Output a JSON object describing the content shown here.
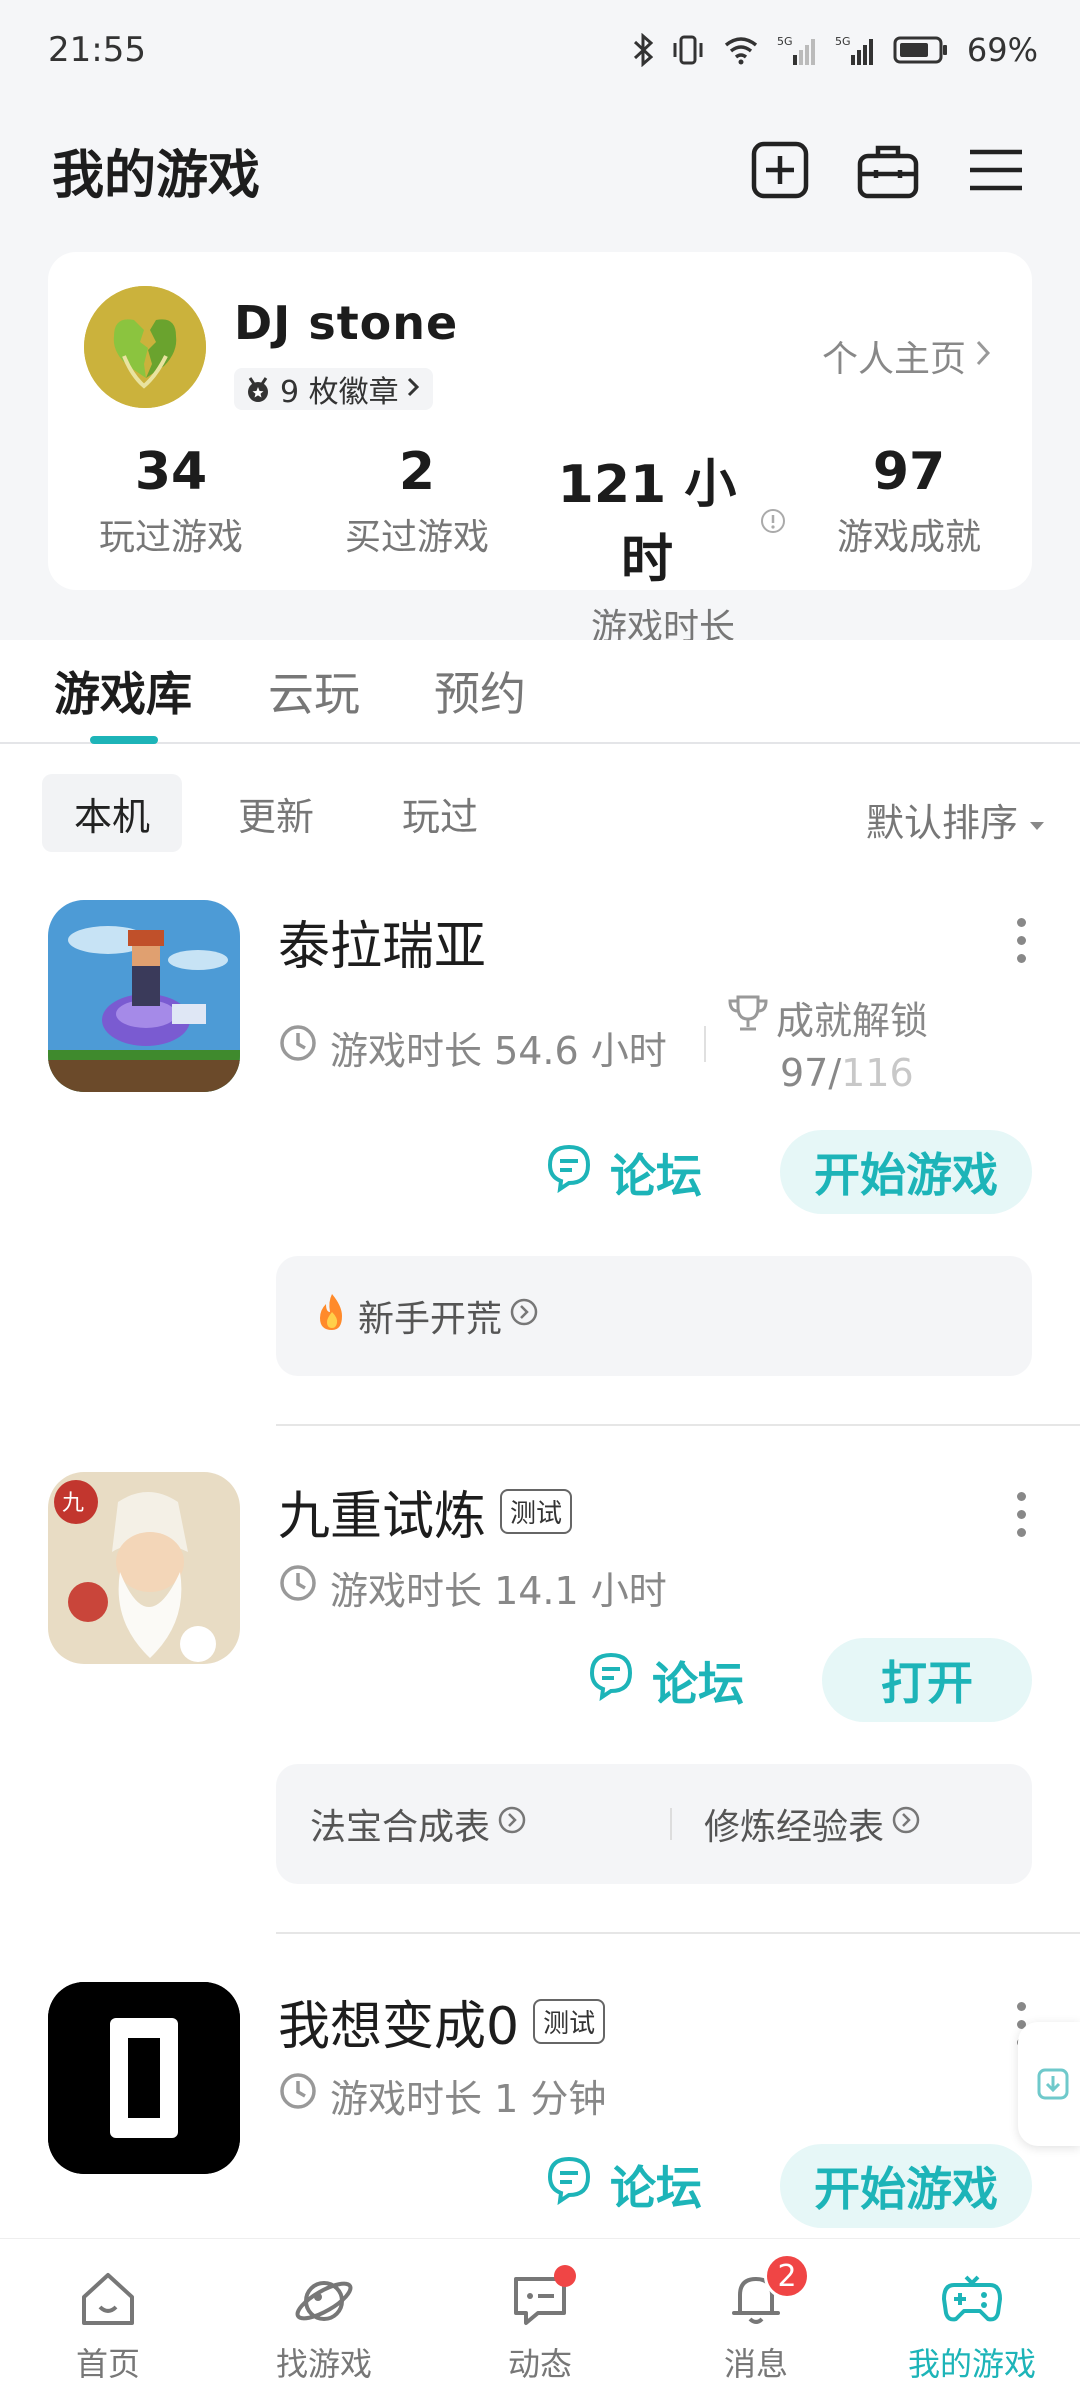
{
  "status_bar": {
    "time": "21:55",
    "battery": "69%",
    "signal1": "5G",
    "signal2": "5G"
  },
  "header": {
    "title": "我的游戏"
  },
  "profile": {
    "username": "DJ  stone",
    "badges": "9 枚徽章",
    "home_link": "个人主页",
    "stats": [
      {
        "value": "34",
        "label": "玩过游戏"
      },
      {
        "value": "2",
        "label": "买过游戏"
      },
      {
        "value": "121 小时",
        "label": "游戏时长"
      },
      {
        "value": "97",
        "label": "游戏成就"
      }
    ]
  },
  "tabs": [
    "游戏库",
    "云玩",
    "预约"
  ],
  "filters": [
    "本机",
    "更新",
    "玩过"
  ],
  "sort_label": "默认排序",
  "games": [
    {
      "name": "泰拉瑞亚",
      "playtime": "游戏时长 54.6 小时",
      "achv_label": "成就解锁",
      "achv_done": "97/",
      "achv_total": "116",
      "forum": "论坛",
      "action": "开始游戏",
      "guides": [
        "新手开荒"
      ]
    },
    {
      "name": "九重试炼",
      "tag": "测试",
      "playtime": "游戏时长 14.1 小时",
      "forum": "论坛",
      "action": "打开",
      "guides": [
        "法宝合成表",
        "修炼经验表"
      ]
    },
    {
      "name": "我想变成0",
      "tag": "测试",
      "playtime": "游戏时长 1 分钟",
      "forum": "论坛",
      "action": "开始游戏"
    }
  ],
  "nav": [
    {
      "label": "首页",
      "icon": "home-icon"
    },
    {
      "label": "找游戏",
      "icon": "planet-icon"
    },
    {
      "label": "动态",
      "icon": "chat-icon"
    },
    {
      "label": "消息",
      "icon": "bell-icon",
      "count": "2"
    },
    {
      "label": "我的游戏",
      "icon": "gamepad-icon"
    }
  ],
  "colors": {
    "accent": "#1db4b8",
    "badge_red": "#f04545"
  }
}
